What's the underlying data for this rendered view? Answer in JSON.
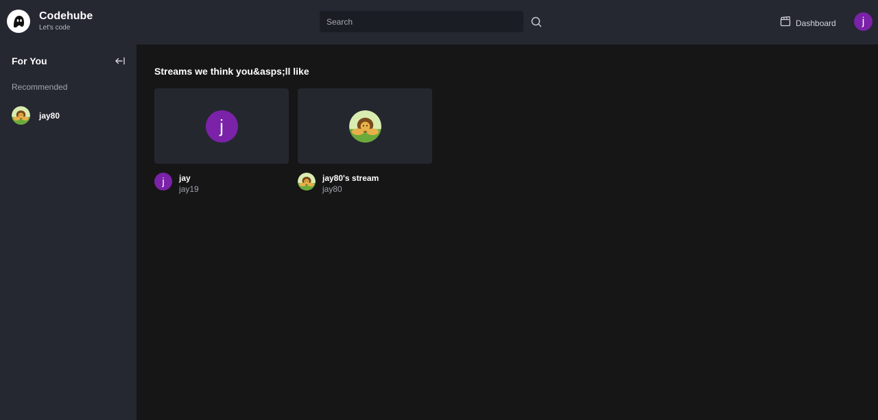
{
  "brand": {
    "name": "Codehube",
    "tagline": "Let's code"
  },
  "search": {
    "placeholder": "Search"
  },
  "header": {
    "dashboard_label": "Dashboard",
    "user_initial": "j"
  },
  "sidebar": {
    "title": "For You",
    "section_label": "Recommended",
    "items": [
      {
        "label": "jay80"
      }
    ]
  },
  "main": {
    "heading": "Streams we think you&asps;ll like",
    "cards": [
      {
        "title": "jay",
        "username": "jay19",
        "initial": "j"
      },
      {
        "title": "jay80's stream",
        "username": "jay80"
      }
    ]
  },
  "colors": {
    "topbar": "#252731",
    "sidebar": "#252731",
    "background": "#161616",
    "avatar_purple": "#7a22a8",
    "card": "#25272f"
  },
  "icons": [
    "logo-ghost-icon",
    "search-icon",
    "clapperboard-icon",
    "collapse-arrow-icon"
  ]
}
